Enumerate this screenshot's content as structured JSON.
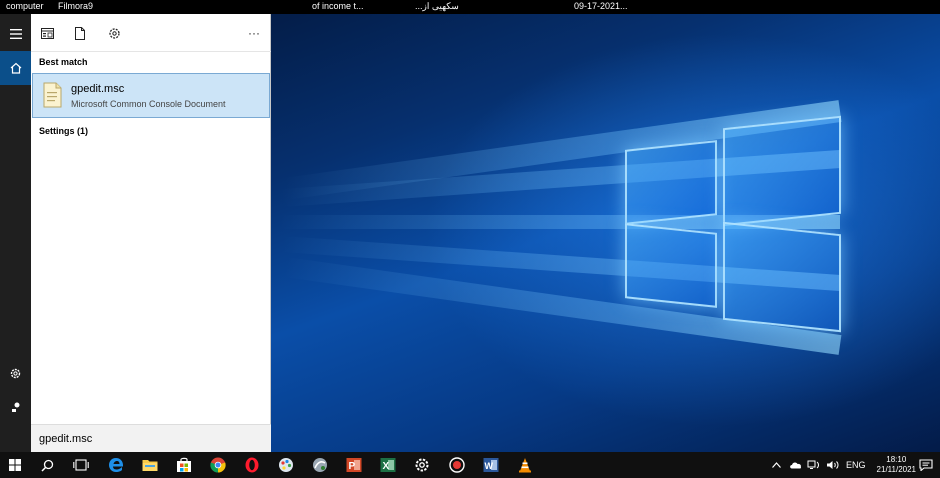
{
  "desktop": {
    "top_items": [
      "computer",
      "Filmora9",
      "of income t...",
      "...سکهیی از",
      "09-17-2021..."
    ]
  },
  "rail": {
    "menu_icon": "hamburger-icon",
    "home_icon": "home-icon",
    "settings_icon": "gear-icon",
    "user_icon": "user-icon"
  },
  "panel": {
    "toolbar": [
      "apps-filter-icon",
      "documents-filter-icon",
      "settings-filter-icon",
      "more-icon"
    ],
    "more_label": "···",
    "best_match_heading": "Best match",
    "best_match": {
      "title": "gpedit.msc",
      "subtitle": "Microsoft Common Console Document",
      "icon": "document-icon"
    },
    "settings_heading": "Settings (1)",
    "search_value": "gpedit.msc"
  },
  "taskbar": {
    "apps": [
      "start-icon",
      "search-icon",
      "task-view-icon",
      "edge-icon",
      "file-explorer-icon",
      "store-icon",
      "chrome-icon",
      "opera-icon",
      "paint-icon",
      "app-icon",
      "powerpoint-icon",
      "excel-icon",
      "settings-icon",
      "recorder-icon",
      "word-icon",
      "vlc-icon"
    ],
    "language": "ENG",
    "time": "18:10",
    "date": "21/11/2021"
  },
  "colors": {
    "selected_bg": "#cce4f7",
    "rail_active": "#0b4f8a",
    "taskbar_bg": "#101010"
  }
}
